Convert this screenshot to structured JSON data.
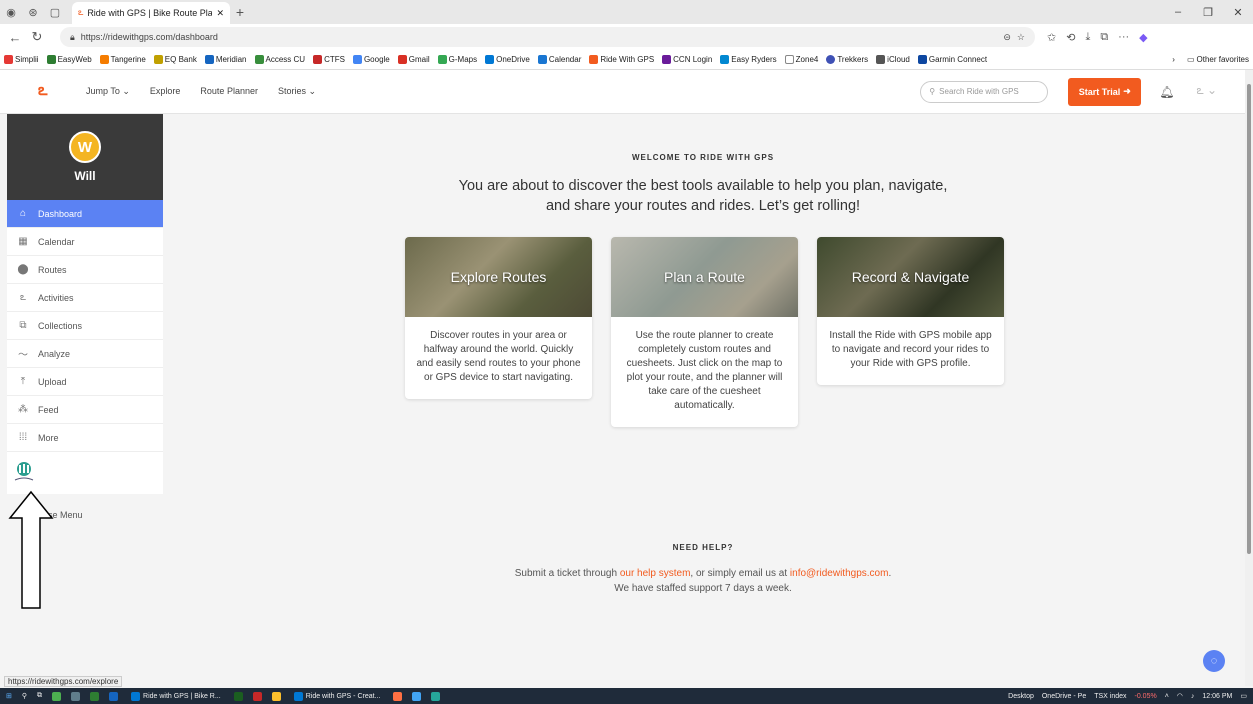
{
  "browser": {
    "tab_title": "Ride with GPS | Bike Route Plann",
    "url": "https://ridewithgps.com/dashboard",
    "favorites": [
      "Simplii",
      "EasyWeb",
      "Tangerine",
      "EQ Bank",
      "Meridian",
      "Access CU",
      "CTFS",
      "Google",
      "Gmail",
      "G-Maps",
      "OneDrive",
      "Calendar",
      "Ride With GPS",
      "CCN Login",
      "Easy Ryders",
      "Zone4",
      "Trekkers",
      "iCloud",
      "Garmin Connect"
    ],
    "other_favorites": "Other favorites",
    "status_url": "https://ridewithgps.com/explore"
  },
  "header": {
    "nav": [
      "Jump To ⌄",
      "Explore",
      "Route Planner",
      "Stories ⌄"
    ],
    "search_placeholder": "Search Ride with GPS",
    "start_trial": "Start Trial"
  },
  "sidebar": {
    "avatar_letter": "W",
    "user_name": "Will",
    "items": [
      {
        "label": "Dashboard",
        "icon": "home-icon"
      },
      {
        "label": "Calendar",
        "icon": "calendar-icon"
      },
      {
        "label": "Routes",
        "icon": "pin-icon"
      },
      {
        "label": "Activities",
        "icon": "bike-icon"
      },
      {
        "label": "Collections",
        "icon": "collections-icon"
      },
      {
        "label": "Analyze",
        "icon": "analyze-icon"
      },
      {
        "label": "Upload",
        "icon": "upload-icon"
      },
      {
        "label": "Feed",
        "icon": "feed-icon"
      },
      {
        "label": "More",
        "icon": "grid-icon"
      }
    ],
    "close_menu": "se Menu"
  },
  "main": {
    "welcome_kicker": "WELCOME TO RIDE WITH GPS",
    "welcome_text": "You are about to discover the best tools available to help you plan, navigate, and share your routes and rides. Let’s get rolling!",
    "cards": [
      {
        "title": "Explore Routes",
        "body": "Discover routes in your area or halfway around the world. Quickly and easily send routes to your phone or GPS device to start navigating."
      },
      {
        "title": "Plan a Route",
        "body": "Use the route planner to create completely custom routes and cuesheets. Just click on the map to plot your route, and the planner will take care of the cuesheet automatically."
      },
      {
        "title": "Record & Navigate",
        "body": "Install the Ride with GPS mobile app to navigate and record your rides to your Ride with GPS profile."
      }
    ],
    "help_kicker": "NEED HELP?",
    "help_line1_a": "Submit a ticket through ",
    "help_link1": "our help system",
    "help_line1_b": ", or simply email us at ",
    "help_link2": "info@ridewithgps.com",
    "help_line1_c": ".",
    "help_line2": "We have staffed support 7 days a week."
  },
  "taskbar": {
    "app1": "Ride with GPS | Bike R...",
    "app2": "Ride with GPS - Creat...",
    "desktop": "Desktop",
    "onedrive": "OneDrive - Pe",
    "tsx": "TSX index",
    "tsx_change": "-0.05%",
    "time": "12:06 PM"
  },
  "colors": {
    "brand_orange": "#f25b1f",
    "active_blue": "#5b82f3",
    "avatar_yellow": "#f4b522"
  }
}
